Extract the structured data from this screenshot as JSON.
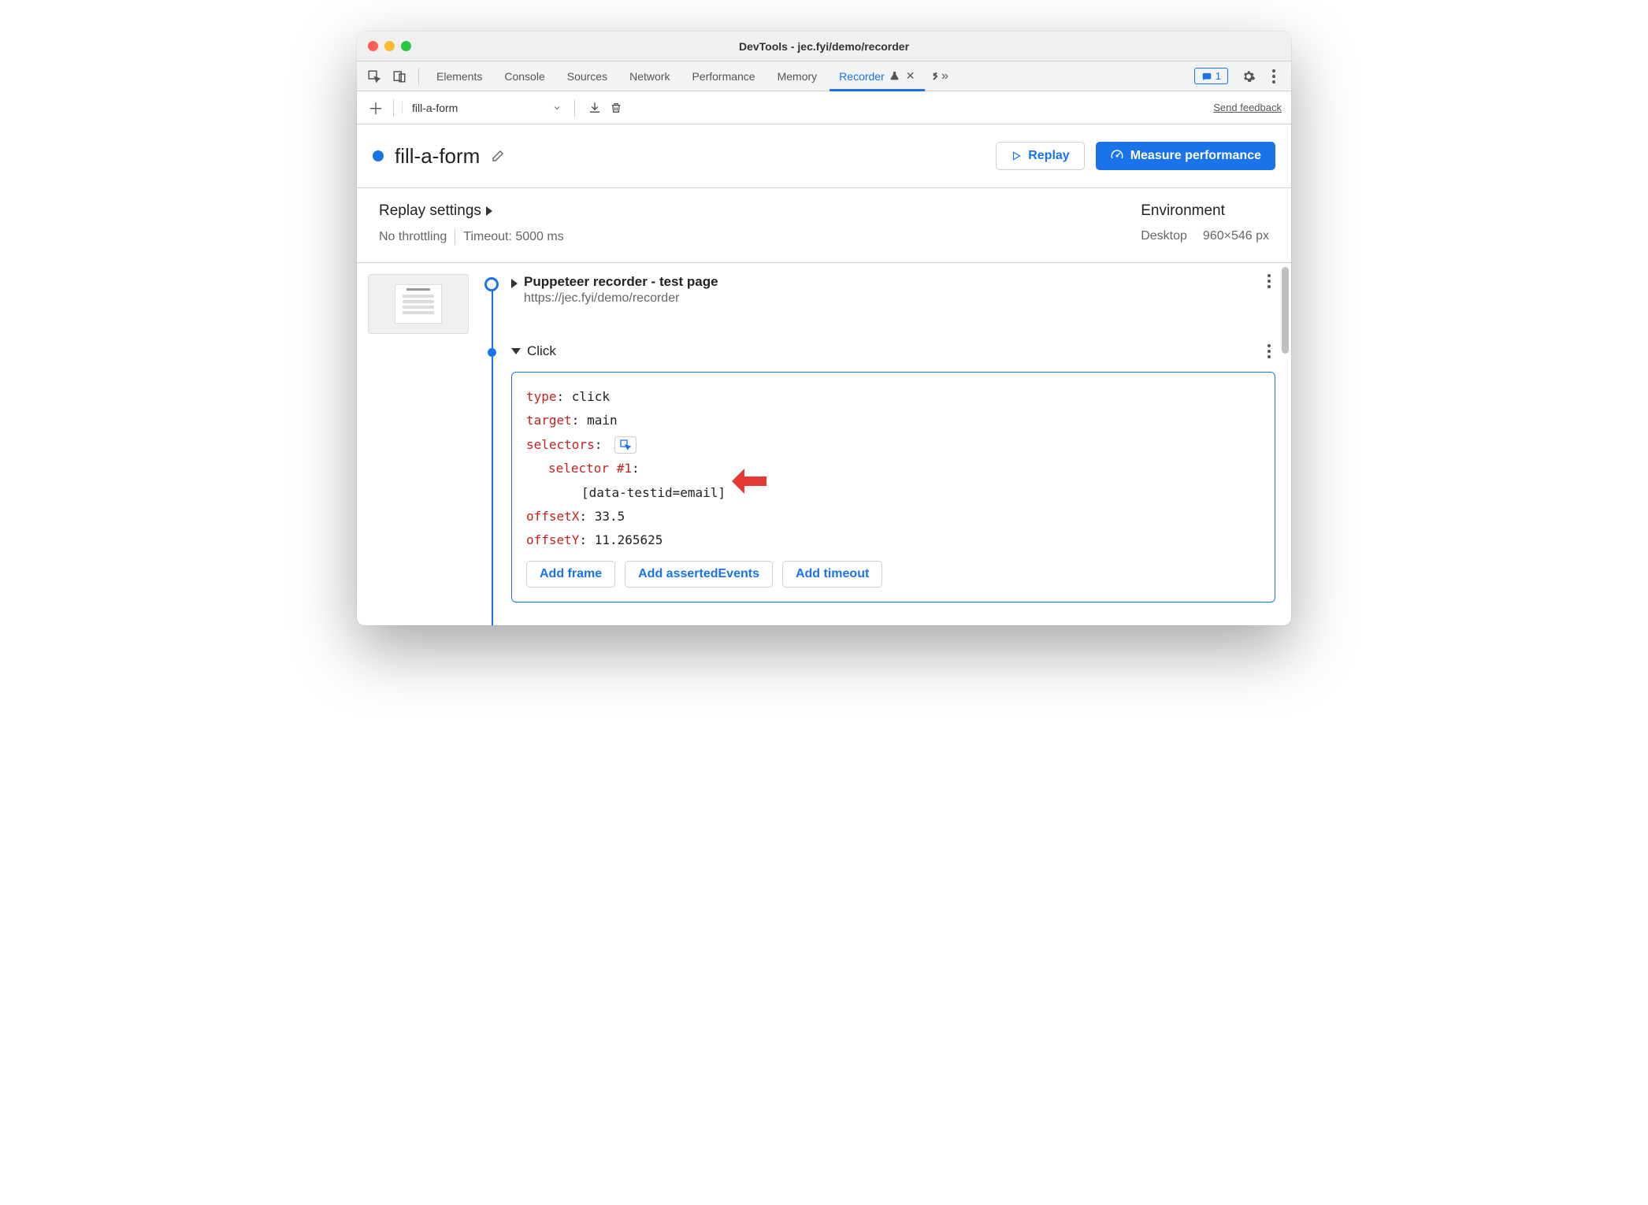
{
  "window": {
    "title": "DevTools - jec.fyi/demo/recorder"
  },
  "tabs": {
    "items": [
      "Elements",
      "Console",
      "Sources",
      "Network",
      "Performance",
      "Memory",
      "Recorder"
    ],
    "active": "Recorder",
    "issues_count": "1"
  },
  "toolbar": {
    "recording_name": "fill-a-form",
    "feedback": "Send feedback"
  },
  "header": {
    "title": "fill-a-form",
    "replay": "Replay",
    "measure": "Measure performance"
  },
  "settings": {
    "replay_title": "Replay settings",
    "throttling": "No throttling",
    "timeout": "Timeout: 5000 ms",
    "env_title": "Environment",
    "device": "Desktop",
    "viewport": "960×546 px"
  },
  "steps": {
    "initial": {
      "title": "Puppeteer recorder - test page",
      "url": "https://jec.fyi/demo/recorder"
    },
    "click": {
      "label": "Click",
      "type_key": "type",
      "type_val": "click",
      "target_key": "target",
      "target_val": "main",
      "selectors_key": "selectors",
      "selector1_key": "selector #1",
      "selector1_val": "[data-testid=email]",
      "offsetX_key": "offsetX",
      "offsetX_val": "33.5",
      "offsetY_key": "offsetY",
      "offsetY_val": "11.265625",
      "add_frame": "Add frame",
      "add_asserted": "Add assertedEvents",
      "add_timeout": "Add timeout"
    }
  }
}
